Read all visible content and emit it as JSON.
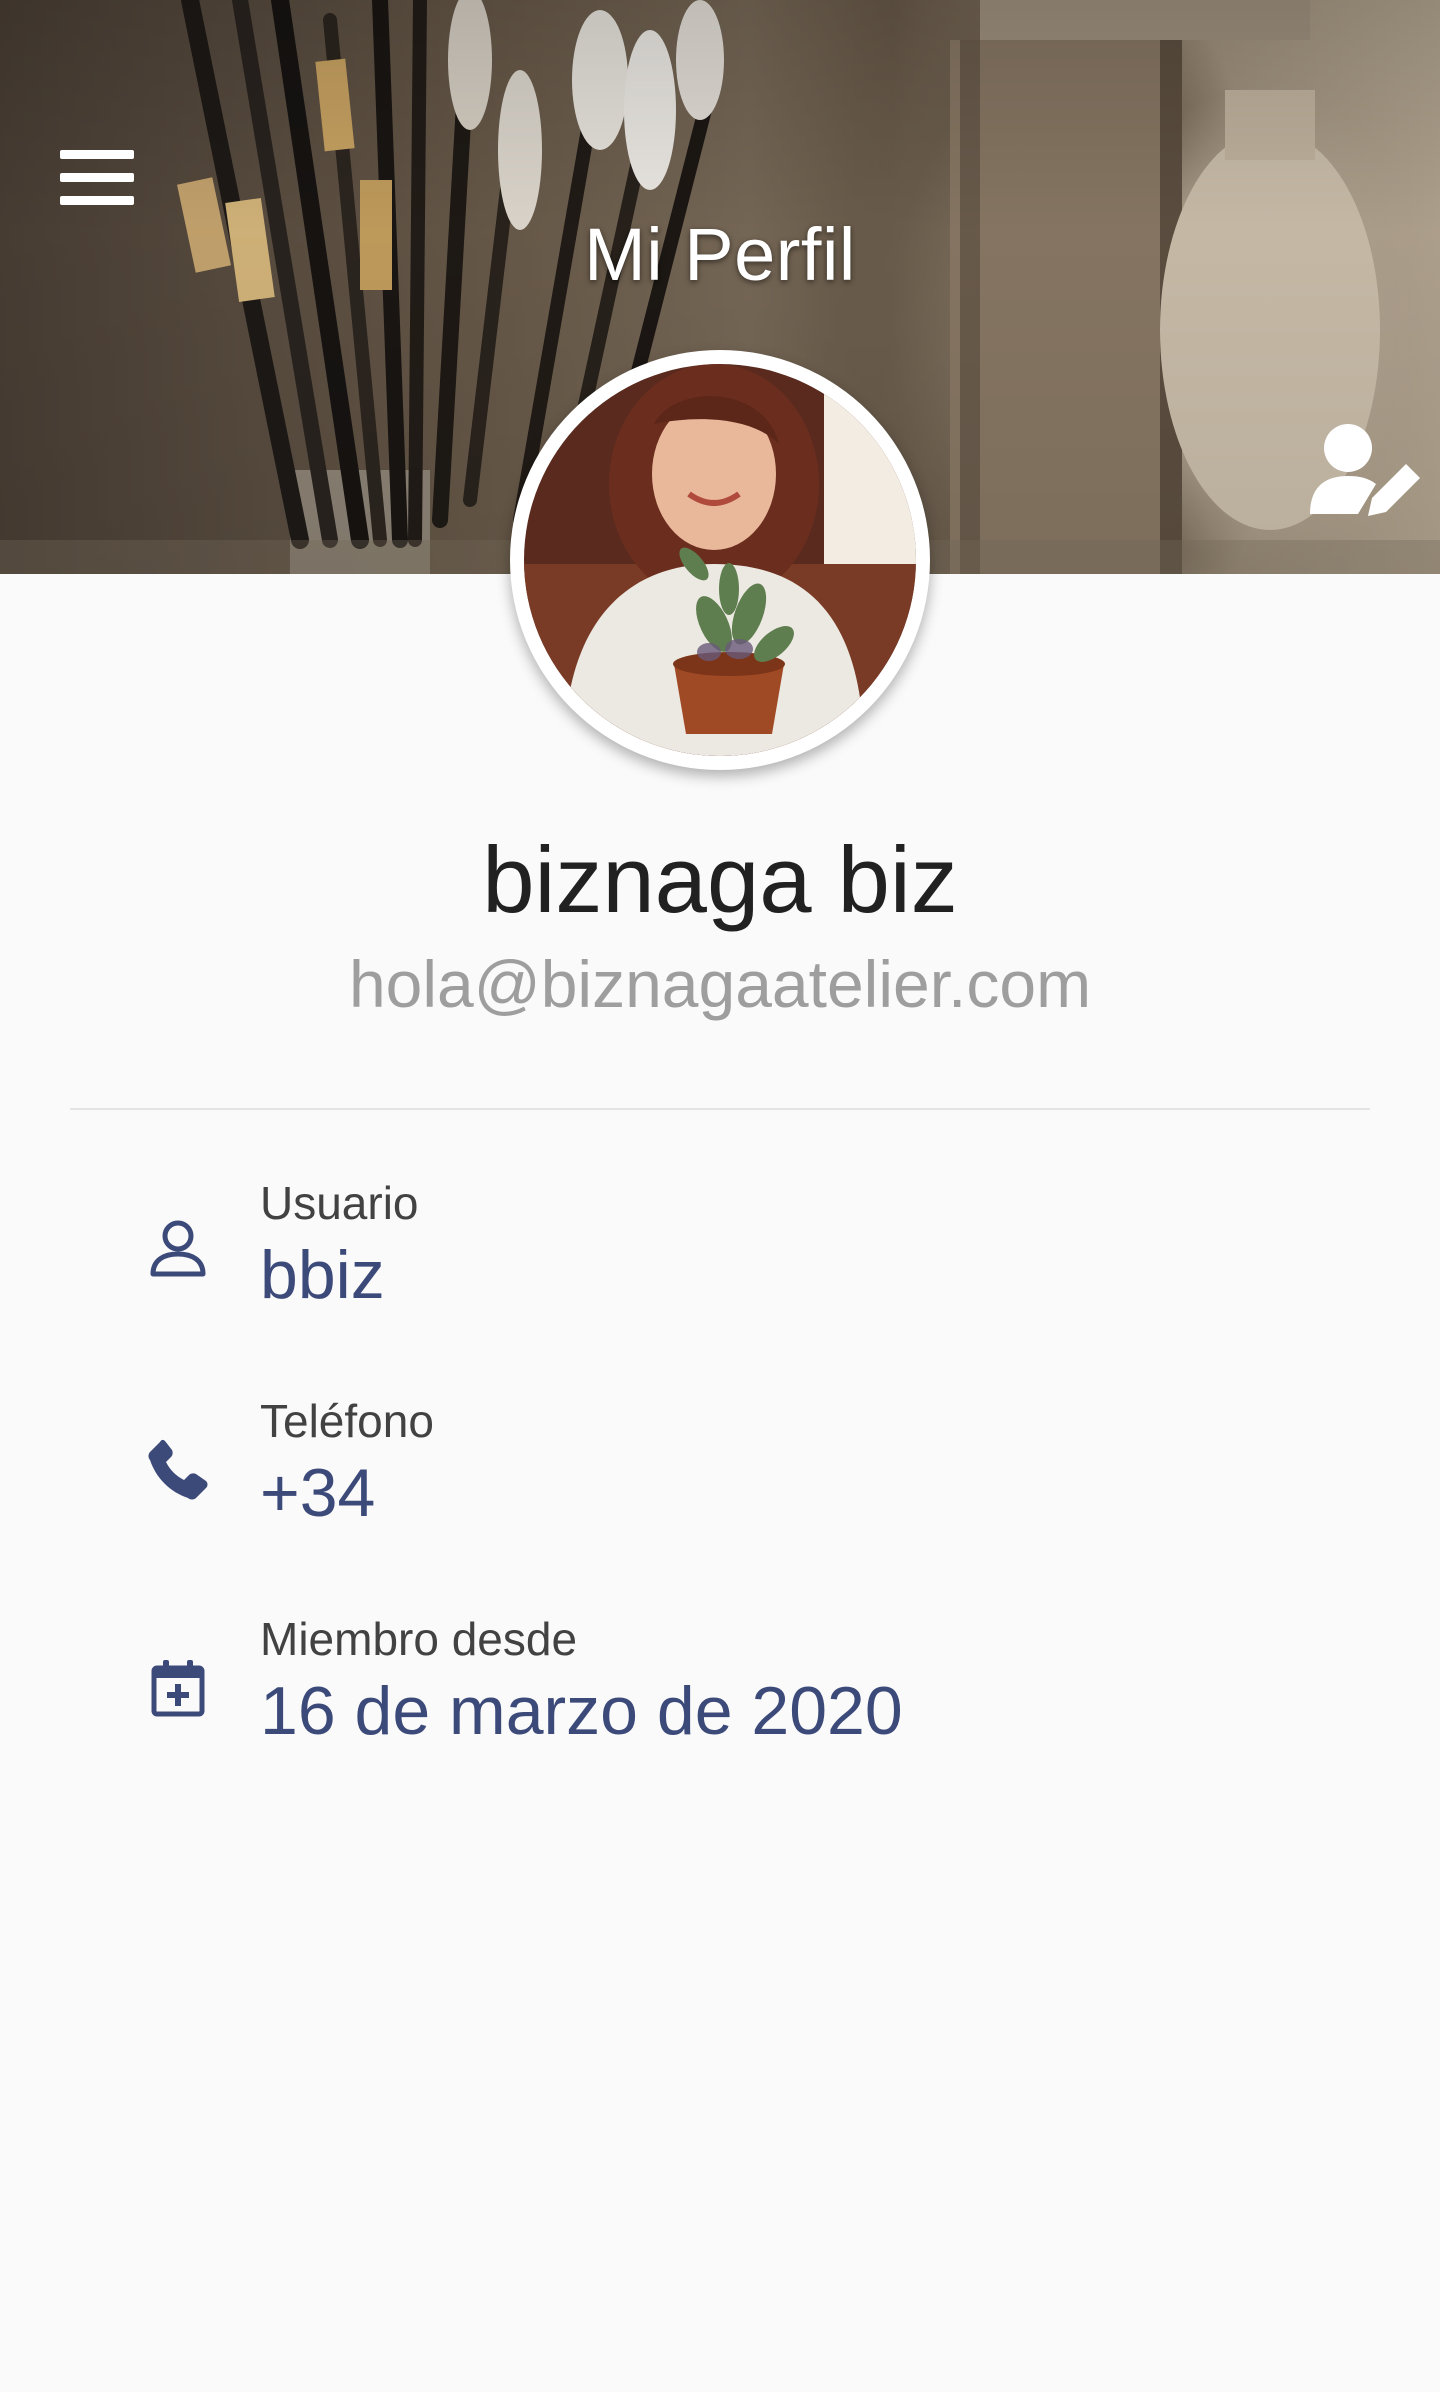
{
  "header": {
    "title": "Mi Perfil",
    "menu_icon": "menu-icon",
    "edit_icon": "user-edit-icon"
  },
  "profile": {
    "name": "biznaga biz",
    "email": "hola@biznagaatelier.com"
  },
  "info": {
    "username": {
      "label": "Usuario",
      "value": "bbiz",
      "icon": "user-icon"
    },
    "phone": {
      "label": "Teléfono",
      "value": "+34",
      "icon": "phone-icon"
    },
    "member_since": {
      "label": "Miembro desde",
      "value": "16 de marzo de 2020",
      "icon": "calendar-plus-icon"
    }
  },
  "colors": {
    "accent": "#3c4a7a",
    "label": "#424242",
    "muted": "#9e9e9e",
    "background": "#fafafa"
  }
}
